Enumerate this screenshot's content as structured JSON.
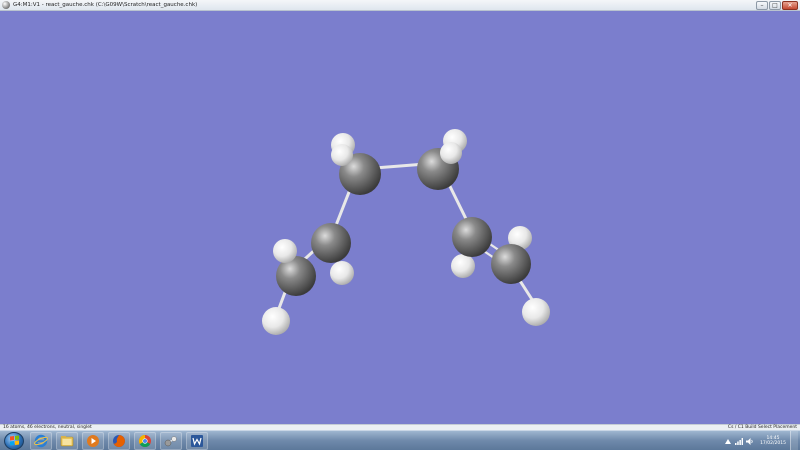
{
  "window": {
    "title": "G4:M1:V1 - react_gauche.chk (C:\\G09W\\Scratch\\react_gauche.chk)",
    "controls": {
      "minimize": "–",
      "maximize": "□",
      "close": "✕"
    }
  },
  "status": {
    "left": "16 atoms, 46 electrons, neutral, singlet",
    "right": "Cs / C1  Build  Select Placement"
  },
  "taskbar": {
    "start_icon": "windows-start-orb",
    "items": [
      {
        "name": "internet-explorer-icon",
        "color": "#2a7fd4"
      },
      {
        "name": "file-explorer-icon",
        "color": "#e8c55a"
      },
      {
        "name": "media-player-icon",
        "color": "#e07a1f"
      },
      {
        "name": "firefox-icon",
        "color": "#e66000"
      },
      {
        "name": "chrome-icon",
        "color": "#4c8bf5"
      },
      {
        "name": "gaussview-icon",
        "color": "#9a9a9a"
      },
      {
        "name": "word-icon",
        "color": "#2b579a"
      }
    ],
    "clock": {
      "time": "14:45",
      "date": "17/02/2015"
    }
  },
  "colors": {
    "viewport_background": "#7b7ecd",
    "carbon_atom": "#6b6b6b",
    "hydrogen_atom": "#f2f2f2",
    "bond": "#e8e8e8"
  }
}
